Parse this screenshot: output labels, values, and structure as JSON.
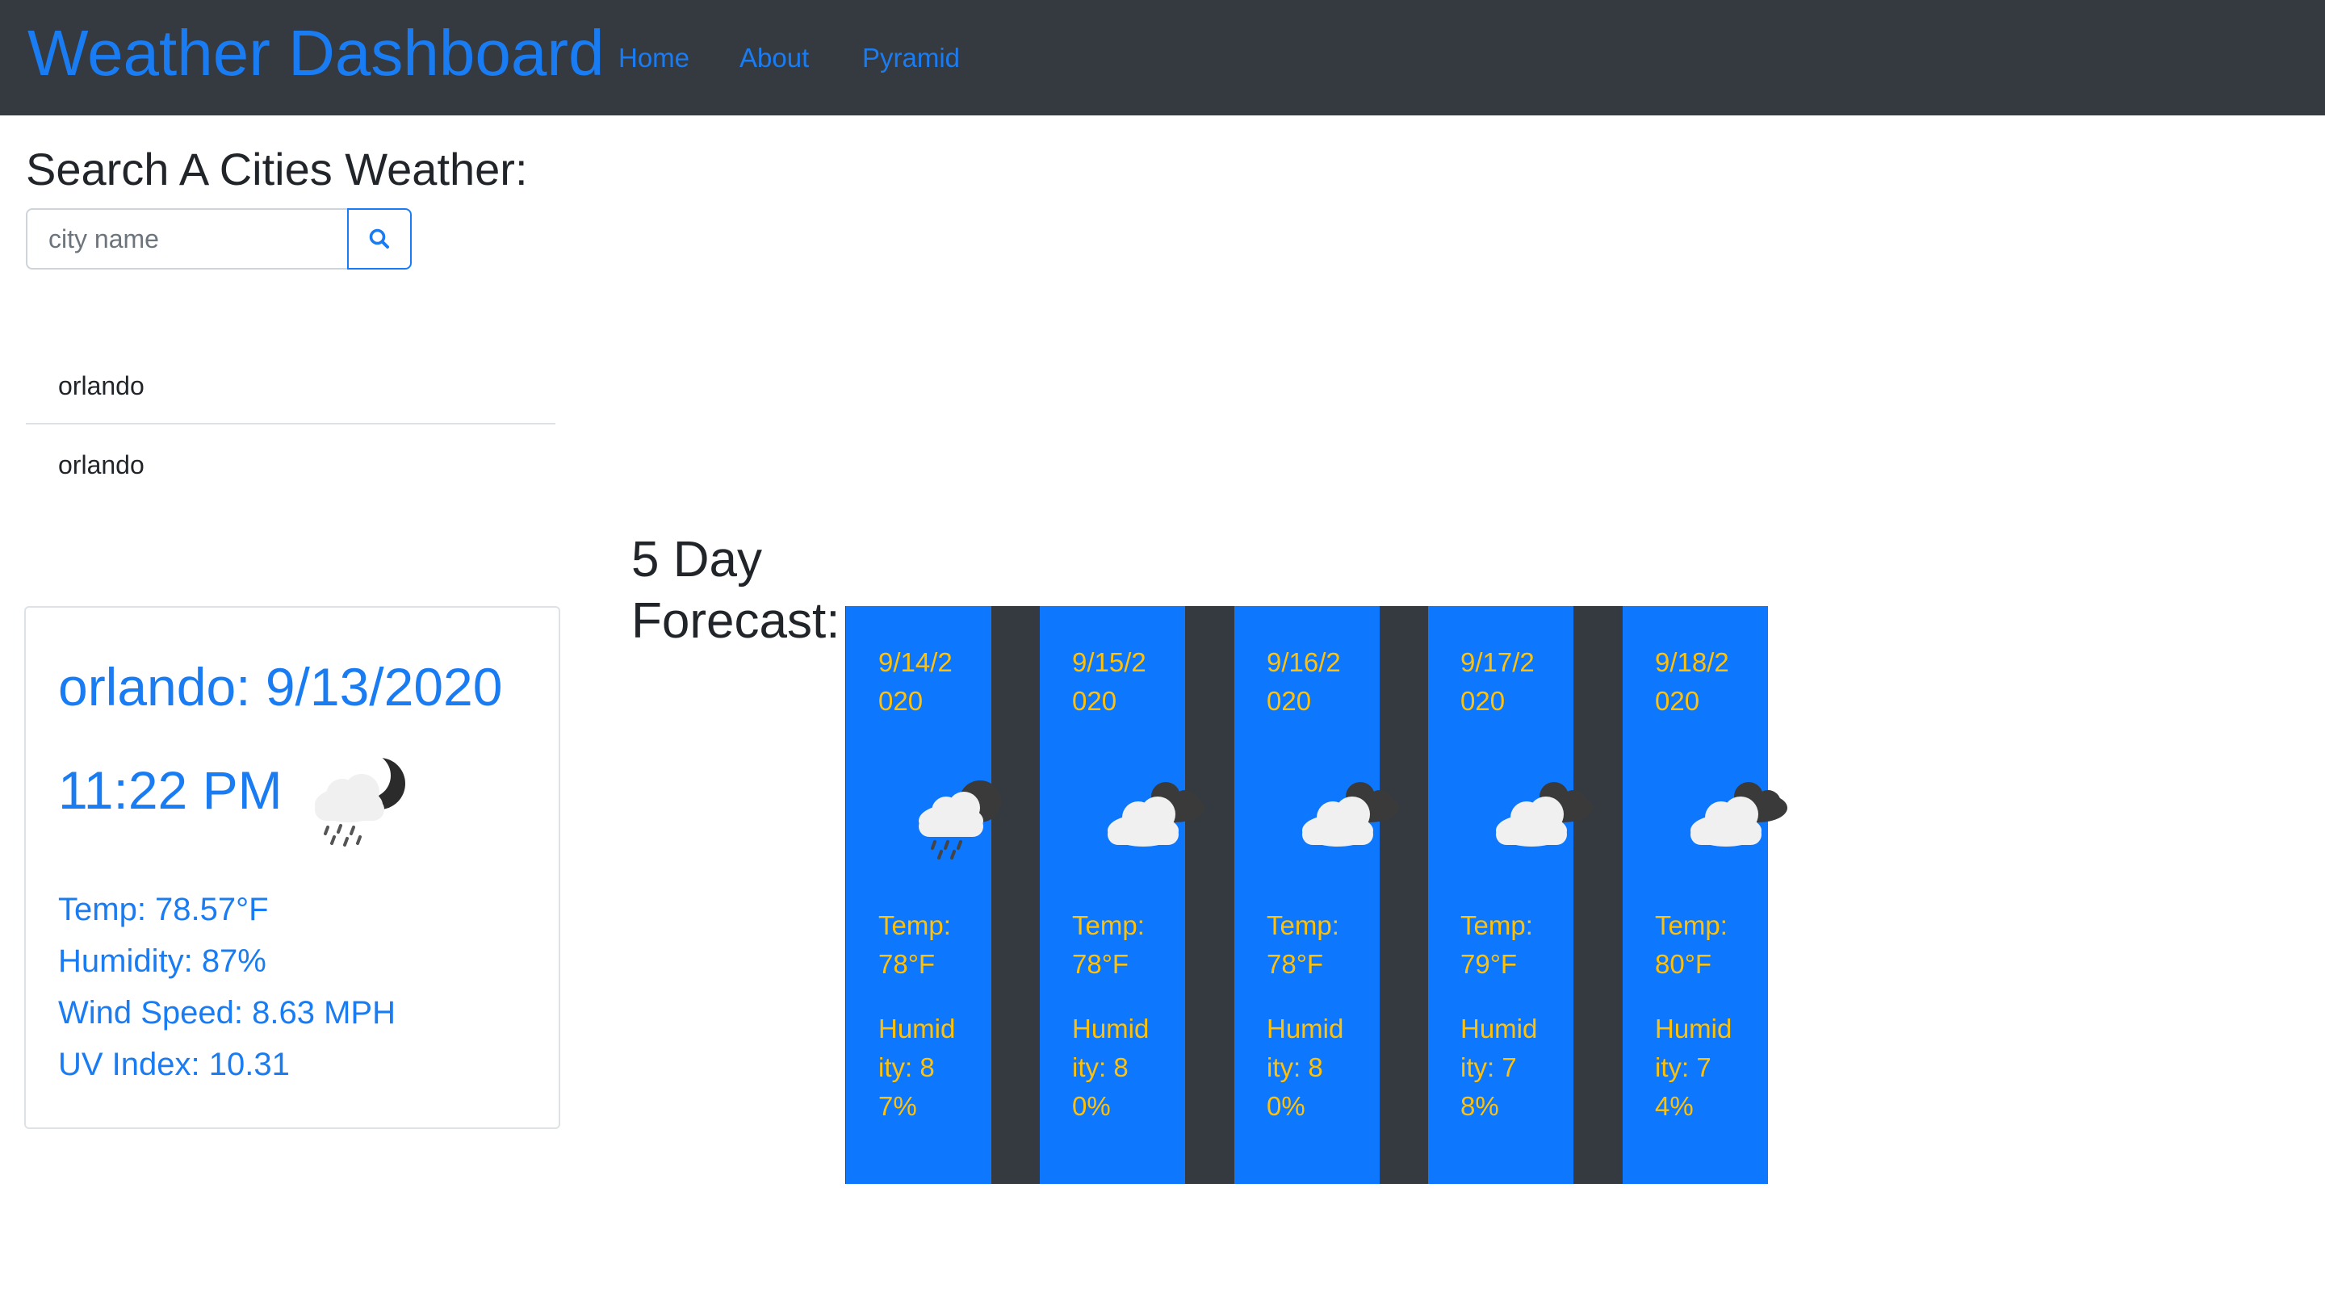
{
  "navbar": {
    "brand": "Weather Dashboard",
    "links": [
      "Home",
      "About",
      "Pyramid"
    ]
  },
  "search": {
    "heading": "Search A Cities Weather:",
    "placeholder": "city name",
    "value": "",
    "button_icon": "search-icon"
  },
  "history": [
    "orlando",
    "orlando"
  ],
  "current": {
    "title": "orlando: 9/13/2020",
    "time": "11:22 PM",
    "icon": "night-rain-cloud-icon",
    "temp": "Temp: 78.57°F",
    "humidity": "Humidity: 87%",
    "wind": "Wind Speed: 8.63 MPH",
    "uv": "UV Index: 10.31"
  },
  "forecast": {
    "heading": "5 Day Forecast:",
    "days": [
      {
        "date": "9/14/2020",
        "icon": "rain-cloud-icon",
        "temp_label": "Temp:",
        "temp": "78°F",
        "humidity_label": "Humidity:",
        "humidity": "87%"
      },
      {
        "date": "9/15/2020",
        "icon": "broken-clouds-icon",
        "temp_label": "Temp:",
        "temp": "78°F",
        "humidity_label": "Humidity:",
        "humidity": "80%"
      },
      {
        "date": "9/16/2020",
        "icon": "broken-clouds-icon",
        "temp_label": "Temp:",
        "temp": "78°F",
        "humidity_label": "Humidity:",
        "humidity": "80%"
      },
      {
        "date": "9/17/2020",
        "icon": "broken-clouds-icon",
        "temp_label": "Temp:",
        "temp": "79°F",
        "humidity_label": "Humidity:",
        "humidity": "78%"
      },
      {
        "date": "9/18/2020",
        "icon": "broken-clouds-icon",
        "temp_label": "Temp:",
        "temp": "80°F",
        "humidity_label": "Humidity:",
        "humidity": "74%"
      }
    ]
  },
  "colors": {
    "navbar_bg": "#343a40",
    "brand": "#1a7cf2",
    "forecast_card_bg": "#0d77fd",
    "forecast_text": "#ffc107"
  }
}
